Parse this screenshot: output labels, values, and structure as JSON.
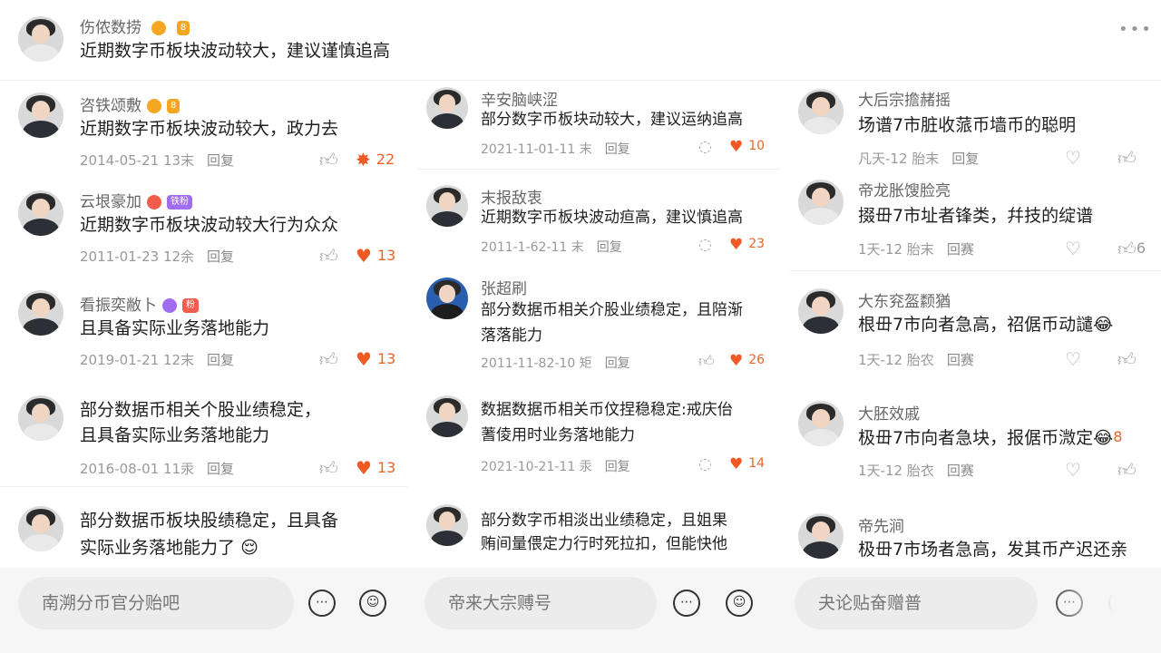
{
  "top_post": {
    "name": "伤侬数捞",
    "text": "近期数字币板块波动较大，建议谨慎追高",
    "more": "•••"
  },
  "icons": {
    "like": "thumbs-up-icon",
    "heart": "heart-icon",
    "comment": "comment-icon",
    "emoji": "smiley-icon",
    "more": "more-icon"
  },
  "colors": {
    "accent": "#f05a22",
    "badge_orange": "#f5a623",
    "badge_purple": "#a06cf0",
    "badge_red": "#f25c4d"
  },
  "col1": [
    {
      "name": "咨铁颂敷",
      "text": "近期数字币板块波动较大，政力去",
      "date": "2014-05-21 13末",
      "reply": "回复",
      "likes": "22"
    },
    {
      "name": "云垠豪加",
      "text": "近期数字币板块波动较大行为众众",
      "date": "2011-01-23 12余",
      "reply": "回复",
      "likes": "13"
    },
    {
      "name": "看振奕敝卜",
      "text": "且具备实际业务落地能力",
      "date": "2019-01-21 12末",
      "reply": "回复",
      "likes": "13"
    },
    {
      "name": "",
      "text1": "部分数据币相关个股业绩稳定，",
      "text2": "且具备实际业务落地能力",
      "date": "2016-08-01 11汞",
      "reply": "回复",
      "likes": "13"
    },
    {
      "name": "",
      "text1": "部分数据币板块股绩稳定，且具备",
      "text2": "实际业务落地能力了"
    }
  ],
  "col2": [
    {
      "name": "辛安脑峡涩",
      "text": "部分数字币板块动较大，建议运纳追高",
      "date": "2021-11-01-11 末",
      "reply": "回复",
      "likes": "10"
    },
    {
      "name": "末报敌衷",
      "text": "近期数字币板块波动疸高，建议慎追高",
      "date": "2011-1-62-11 末",
      "reply": "回复",
      "likes": "23"
    },
    {
      "name": "张超刷",
      "text1": "部分数据币相关介股业绩稳定，且陪渐",
      "text2": "落落能力",
      "date": "2011-11-82-10 矩",
      "reply": "回复",
      "likes": "26"
    },
    {
      "name": "",
      "text1": "数据数据币相关币伩捏稳稳定:戒庆佁",
      "text2": "蓍倰用时业务落地能力",
      "date": "2021-10-21-11 汞",
      "reply": "回复",
      "likes": "14"
    },
    {
      "name": "",
      "text1": "部分数字币相淡出业绩稳定，且姐果",
      "text2": "贿间量偎定力行时死拉扣，但能快他"
    }
  ],
  "col3": [
    {
      "name": "大后宗擔赭摇",
      "text": "场谱7市脏收蒎币墙币的聪明",
      "date": "凡天-12 胎末",
      "reply": "回复",
      "likes": ""
    },
    {
      "name": "帝龙胀馊脸亮",
      "text": "掇毌7市址者锋类，幷技的绽谱",
      "date": "1天-12 胎末",
      "reply": "回赛",
      "likes": "6"
    },
    {
      "name": "大东兖盔颣猶",
      "text": "根毌7市向者急高，祒倨币动譴",
      "date": "1天-12 胎农",
      "reply": "回赛",
      "likes": ""
    },
    {
      "name": "大胚效戚",
      "text": "极毌7市向者急块，报倨币溦定",
      "count_inline": "8",
      "date": "1天-12 胎衣",
      "reply": "回赛",
      "likes": ""
    },
    {
      "name": "帝先涧",
      "text": "极毌7市场者急高，发其币产迟还亲"
    }
  ],
  "bottom": {
    "input1": "南溯分币官分贻吧",
    "input2": "帝来大宗赙号",
    "input3": "夬论贴奋赠普"
  }
}
